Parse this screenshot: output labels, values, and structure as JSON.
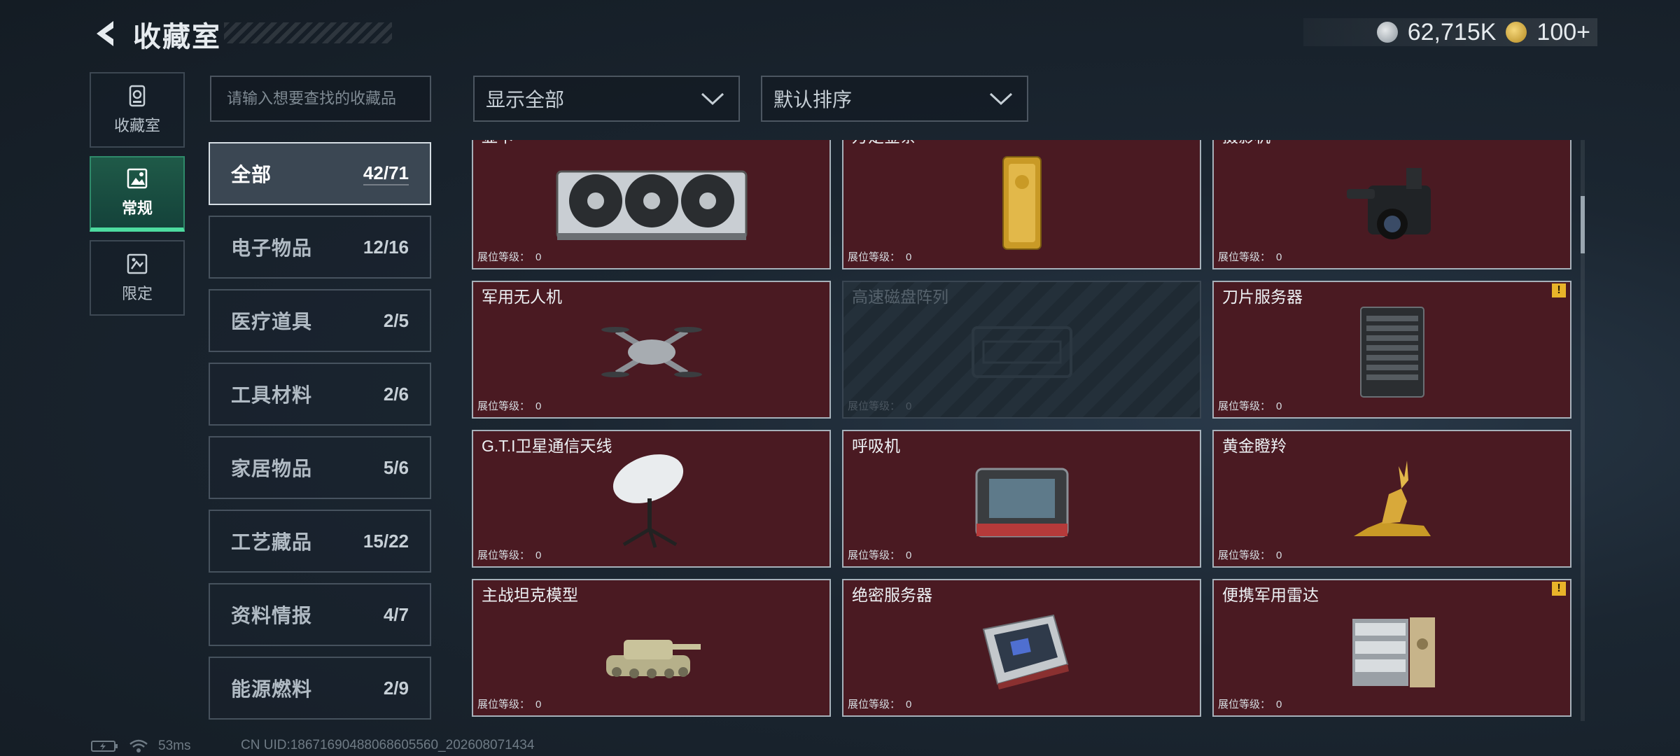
{
  "header": {
    "title": "收藏室"
  },
  "currency": [
    {
      "icon": "silver-coin-icon",
      "value": "62,715K"
    },
    {
      "icon": "gold-coin-icon",
      "value": "100+"
    }
  ],
  "side_nav": [
    {
      "label": "收藏室",
      "icon": "collection-room-icon",
      "active": false
    },
    {
      "label": "常规",
      "icon": "regular-card-icon",
      "active": true
    },
    {
      "label": "限定",
      "icon": "limited-card-icon",
      "active": false
    }
  ],
  "search": {
    "placeholder": "请输入想要查找的收藏品"
  },
  "filter": {
    "value": "显示全部"
  },
  "sort": {
    "value": "默认排序"
  },
  "categories": [
    {
      "name": "全部",
      "count": "42/71",
      "active": true
    },
    {
      "name": "电子物品",
      "count": "12/16"
    },
    {
      "name": "医疗道具",
      "count": "2/5"
    },
    {
      "name": "工具材料",
      "count": "2/6"
    },
    {
      "name": "家居物品",
      "count": "5/6"
    },
    {
      "name": "工艺藏品",
      "count": "15/22"
    },
    {
      "name": "资料情报",
      "count": "4/7"
    },
    {
      "name": "能源燃料",
      "count": "2/9"
    }
  ],
  "items": [
    {
      "name": "显卡",
      "level": "0",
      "art": "gpu-icon"
    },
    {
      "name": "万足金条",
      "level": "0",
      "art": "gold-bar-icon"
    },
    {
      "name": "摄影机",
      "level": "0",
      "art": "camera-icon"
    },
    {
      "name": "军用无人机",
      "level": "0",
      "art": "drone-icon"
    },
    {
      "name": "高速磁盘阵列",
      "level": "0",
      "art": "disk-array-icon",
      "locked": true
    },
    {
      "name": "刀片服务器",
      "level": "0",
      "art": "blade-server-icon",
      "warning": true
    },
    {
      "name": "G.T.I卫星通信天线",
      "level": "0",
      "art": "satellite-dish-icon"
    },
    {
      "name": "呼吸机",
      "level": "0",
      "art": "ventilator-icon"
    },
    {
      "name": "黄金瞪羚",
      "level": "0",
      "art": "golden-gazelle-icon"
    },
    {
      "name": "主战坦克模型",
      "level": "0",
      "art": "tank-icon"
    },
    {
      "name": "绝密服务器",
      "level": "0",
      "art": "secret-server-icon"
    },
    {
      "name": "便携军用雷达",
      "level": "0",
      "art": "radar-icon",
      "warning": true
    }
  ],
  "level_label": "展位等级：",
  "status": {
    "latency": "53ms",
    "uid": "CN UID:18671690488068605560_202608071434"
  }
}
